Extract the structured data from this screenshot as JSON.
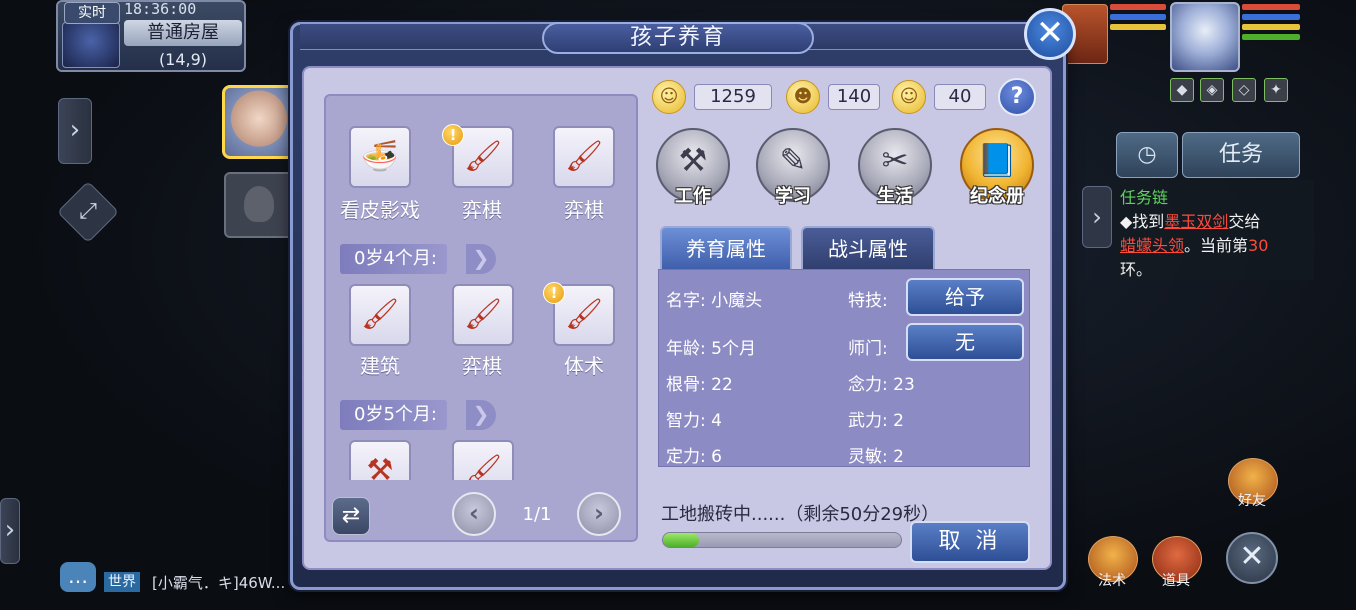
{
  "hud": {
    "realtime_label": "实时",
    "clock": "18:36:00",
    "location_name": "普通房屋",
    "coordinates": "(14,9)",
    "task_timer_icon": "clock-icon",
    "task_tab_label": "任务",
    "task_chain_title": "任务链",
    "task_line1_prefix": "◆找到",
    "task_line1_target": "墨玉双剑",
    "task_line1_suffix": "交给",
    "task_line2_target": "蜡蠓头领",
    "task_line2_mid": "。当前第",
    "task_line2_count": "30",
    "task_line3": "环。",
    "friends_label": "好友",
    "magic_label": "法术",
    "items_label": "道具",
    "chat_channel": "世界",
    "chat_message": "[小霸气．キ]46W..."
  },
  "dialog": {
    "title": "孩子养育",
    "close_icon": "close-icon",
    "currency": {
      "coins": "1259",
      "mood": "140",
      "fatigue": "40"
    },
    "help_label": "?",
    "actions": [
      {
        "label": "工作",
        "icon": "anvil-icon"
      },
      {
        "label": "学习",
        "icon": "brush-icon"
      },
      {
        "label": "生活",
        "icon": "basket-icon"
      },
      {
        "label": "纪念册",
        "icon": "album-icon"
      }
    ],
    "schedule": {
      "row1": [
        {
          "label": "看皮影戏",
          "icon": "bowl-icon",
          "alert": false
        },
        {
          "label": "弈棋",
          "icon": "brush-icon",
          "alert": true
        },
        {
          "label": "弈棋",
          "icon": "brush-icon",
          "alert": false
        }
      ],
      "age_4_label": "0岁4个月:",
      "row2": [
        {
          "label": "建筑",
          "icon": "brush-icon",
          "alert": false
        },
        {
          "label": "弈棋",
          "icon": "brush-icon",
          "alert": false
        },
        {
          "label": "体术",
          "icon": "brush-icon",
          "alert": true
        }
      ],
      "age_5_label": "0岁5个月:",
      "row3": [
        {
          "icon": "anvil-icon"
        },
        {
          "icon": "brush-icon"
        }
      ],
      "page": "1/1",
      "alert_mark": "!"
    },
    "tabs": {
      "nurture": "养育属性",
      "combat": "战斗属性"
    },
    "attributes": {
      "name_label": "名字:",
      "name_value": "小魔头",
      "skill_label": "特技:",
      "skill_button": "给予",
      "age_label": "年龄:",
      "age_value": "5个月",
      "school_label": "师门:",
      "school_button": "无",
      "root_label": "根骨:",
      "root_value": "22",
      "mind_label": "念力:",
      "mind_value": "23",
      "int_label": "智力:",
      "int_value": "4",
      "force_label": "武力:",
      "force_value": "2",
      "calm_label": "定力:",
      "calm_value": "6",
      "agility_label": "灵敏:",
      "agility_value": "2"
    },
    "status": {
      "text": "工地搬砖中......（剩余50分29秒）",
      "progress_fraction": 0.15,
      "cancel_label": "取 消"
    }
  },
  "colors": {
    "dialog_frame": "#2f3e6a",
    "dialog_body": "#c9c8e4",
    "accent_blue": "#3e5eaa",
    "progress_green": "#4cb02a",
    "alert_gold": "#e79a0c"
  }
}
